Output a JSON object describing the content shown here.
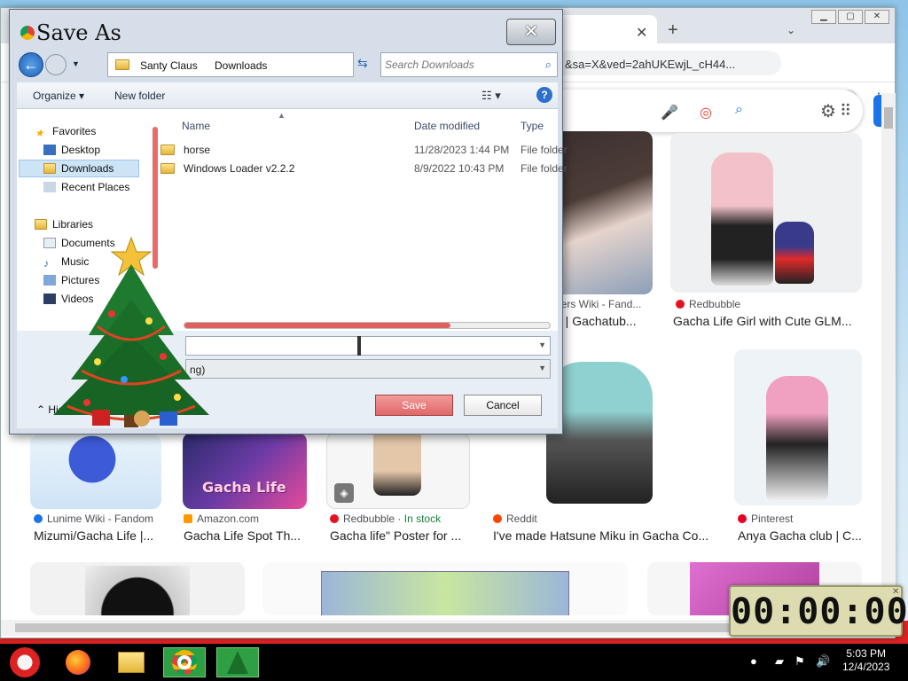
{
  "browser": {
    "url": "&sa=X&ved=2ahUKEwjL_cH44...",
    "tab_close": "✕",
    "new_tab": "+"
  },
  "results": [
    {
      "source": "Lunime Wiki - Fandom",
      "title": "Mizumi/Gacha Life |...",
      "color": "#1a73e8"
    },
    {
      "source": "Amazon.com",
      "title": "Gacha Life Spot Th...",
      "color": "#ff9900"
    },
    {
      "source": "Redbubble",
      "in_stock": "· In stock",
      "title": "Gacha life\" Poster for ...",
      "color": "#e41321"
    },
    {
      "source": "Reddit",
      "title": "I've made Hatsune Miku in Gacha Co...",
      "color": "#ff4500"
    },
    {
      "source": "Pinterest",
      "title": "Anya Gacha club | C...",
      "color": "#e60023"
    },
    {
      "source": "bers Wiki - Fand...",
      "title": "e | Gachatub...",
      "color": "#1a73e8"
    },
    {
      "source": "Redbubble",
      "title": "Gacha Life Girl with Cute GLM...",
      "color": "#e41321"
    }
  ],
  "results_banner_text": "Gacha Life",
  "dialog": {
    "title": "Save As",
    "close": "✕",
    "breadcrumb": [
      "Santy Claus",
      "Downloads"
    ],
    "search_placeholder": "Search Downloads",
    "organize": "Organize ▾",
    "new_folder": "New folder",
    "nav": {
      "favorites": "Favorites",
      "desktop": "Desktop",
      "downloads": "Downloads",
      "recent": "Recent Places",
      "libraries": "Libraries",
      "documents": "Documents",
      "music": "Music",
      "pictures": "Pictures",
      "videos": "Videos"
    },
    "columns": {
      "name": "Name",
      "date": "Date modified",
      "type": "Type"
    },
    "files": [
      {
        "name": "horse",
        "date": "11/28/2023 1:44 PM",
        "type": "File folder"
      },
      {
        "name": "Windows Loader v2.2.2",
        "date": "8/9/2022 10:43 PM",
        "type": "File folder"
      }
    ],
    "save_type_visible": "ng)",
    "save": "Save",
    "cancel": "Cancel",
    "hide_folders": "Hide Folders"
  },
  "taskbar": {
    "time": "5:03 PM",
    "date": "12/4/2023"
  },
  "timer": "00:00:00"
}
